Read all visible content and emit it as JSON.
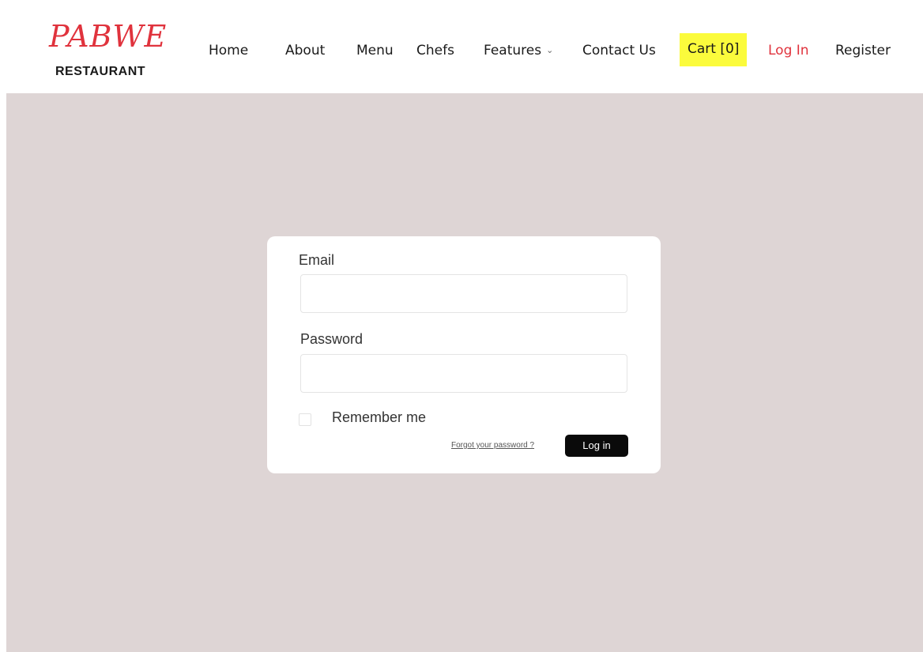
{
  "brand": {
    "name": "PABWE",
    "subtitle": "RESTAURANT",
    "color": "#e0333d"
  },
  "nav": {
    "items": [
      {
        "label": "Home"
      },
      {
        "label": "About"
      },
      {
        "label": "Menu"
      },
      {
        "label": "Chefs"
      },
      {
        "label": "Features",
        "icon": "chevron-down-icon"
      },
      {
        "label": "Contact Us"
      },
      {
        "label": "Cart [0]",
        "highlight": "#fbfb3c"
      },
      {
        "label": "Log In",
        "color": "#e0333d"
      },
      {
        "label": "Register"
      }
    ]
  },
  "login_form": {
    "email_label": "Email",
    "email_value": "",
    "password_label": "Password",
    "password_value": "",
    "remember_label": "Remember me",
    "remember_checked": false,
    "forgot_link": "Forgot your password ?",
    "submit_label": "Log in"
  },
  "colors": {
    "background": "#ded5d5",
    "card": "#ffffff",
    "button": "#0a0a0a"
  }
}
